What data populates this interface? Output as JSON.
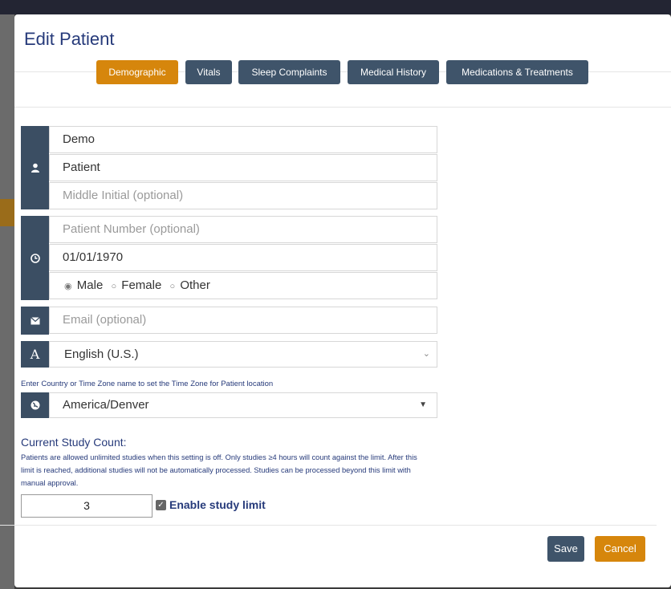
{
  "modal": {
    "title": "Edit Patient"
  },
  "tabs": [
    {
      "label": "Demographic",
      "active": true
    },
    {
      "label": "Vitals",
      "active": false
    },
    {
      "label": "Sleep Complaints",
      "active": false
    },
    {
      "label": "Medical History",
      "active": false
    },
    {
      "label": "Medications & Treatments",
      "active": false
    }
  ],
  "form": {
    "first_name": {
      "value": "Demo"
    },
    "last_name": {
      "value": "Patient"
    },
    "middle_initial": {
      "placeholder": "Middle Initial (optional)"
    },
    "patient_number": {
      "placeholder": "Patient Number (optional)"
    },
    "dob": {
      "value": "01/01/1970"
    },
    "gender": {
      "options": [
        "Male",
        "Female",
        "Other"
      ],
      "selected": "Male"
    },
    "email": {
      "placeholder": "Email (optional)"
    },
    "language": {
      "value": "English (U.S.)"
    },
    "timezone_hint": "Enter Country or Time Zone name to set the Time Zone for Patient location",
    "timezone": {
      "value": "America/Denver"
    }
  },
  "study": {
    "title": "Current Study Count:",
    "description": "Patients are allowed unlimited studies when this setting is off. Only studies ≥4 hours will count against the limit. After this limit is reached, additional studies will not be automatically processed. Studies can be processed beyond this limit with manual approval.",
    "count": "3",
    "limit_label": "Enable study limit",
    "limit_enabled": true
  },
  "footer": {
    "save_label": "Save",
    "cancel_label": "Cancel"
  },
  "colors": {
    "primary_dark": "#3f546a",
    "accent_orange": "#d6860c",
    "title_navy": "#263a7a"
  },
  "icons": {
    "name_group": "user-icon",
    "identity_group": "clock-icon",
    "email": "envelope-icon",
    "language": "font-a-icon",
    "timezone": "globe-icon",
    "dropdown": "chevron-down-icon",
    "select_caret": "caret-down-icon"
  }
}
